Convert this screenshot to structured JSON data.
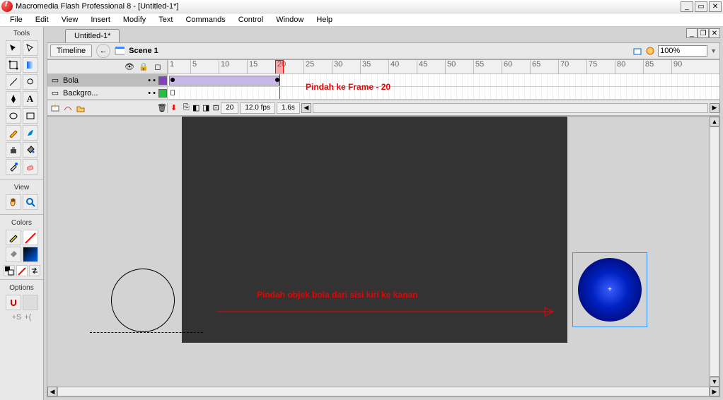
{
  "app": {
    "title": "Macromedia Flash Professional 8 - [Untitled-1*]"
  },
  "menus": [
    "File",
    "Edit",
    "View",
    "Insert",
    "Modify",
    "Text",
    "Commands",
    "Control",
    "Window",
    "Help"
  ],
  "doc_tab": "Untitled-1*",
  "timeline_btn": "Timeline",
  "scene": "Scene 1",
  "zoom": "100%",
  "panels": {
    "tools": "Tools",
    "view": "View",
    "colors": "Colors",
    "options": "Options"
  },
  "layers": [
    {
      "name": "Bola",
      "color": "#8040c0",
      "selected": true
    },
    {
      "name": "Backgro...",
      "color": "#20c040",
      "selected": false
    }
  ],
  "ruler_ticks": [
    1,
    5,
    10,
    15,
    20,
    25,
    30,
    35,
    40,
    45,
    50,
    55,
    60,
    65,
    70,
    75,
    80,
    85,
    90
  ],
  "playhead_frame": 20,
  "status": {
    "frame": "20",
    "fps": "12.0 fps",
    "time": "1.6s"
  },
  "annotations": {
    "top": "Pindah ke Frame - 20",
    "mid": "Pindah objek bola dari sisi kiri ke kanan"
  }
}
